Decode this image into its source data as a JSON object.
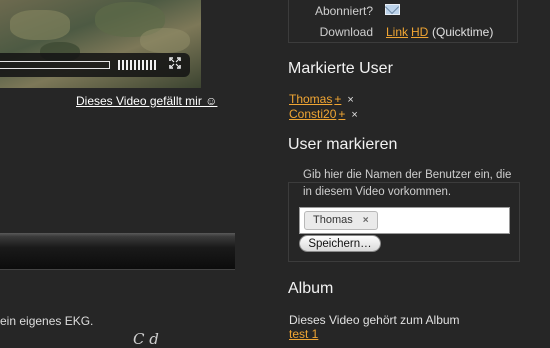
{
  "video": {
    "like_text": "Dieses Video gefällt mir ☺"
  },
  "left": {
    "description_fragment": "ein eigenes EKG.",
    "signature_fragment": "C  d"
  },
  "info": {
    "subscribed_label": "Abonniert?",
    "download_label": "Download",
    "link_label": "Link",
    "hd_label": "HD",
    "format_label": "(Quicktime)"
  },
  "marked_users": {
    "title": "Markierte User",
    "users": [
      {
        "name": "Thomas",
        "plus": "+",
        "remove": "×"
      },
      {
        "name": "Consti20",
        "plus": "+",
        "remove": "×"
      }
    ]
  },
  "mark_users": {
    "title": "User markieren",
    "hint": "Gib hier die Namen der Benutzer ein, die in diesem Video vorkommen.",
    "tags": [
      {
        "name": "Thomas",
        "remove": "×"
      }
    ],
    "save_label": "Speichern…"
  },
  "album": {
    "title": "Album",
    "text": "Dieses Video gehört zum Album",
    "link": "test 1"
  },
  "colors": {
    "background": "#262626",
    "link": "#f0a533",
    "heading": "#f2f2f2"
  },
  "icons": {
    "subscribe": "envelope-icon",
    "fullscreen": "fullscreen-icon"
  }
}
